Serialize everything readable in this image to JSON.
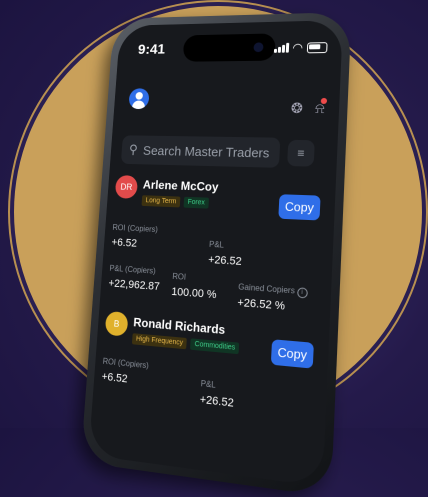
{
  "status": {
    "time": "9:41"
  },
  "search": {
    "placeholder": "Search Master Traders"
  },
  "traders": [
    {
      "initials": "DR",
      "name": "Arlene McCoy",
      "tags": [
        "Long Term",
        "Forex"
      ],
      "copy_label": "Copy",
      "roi_copiers_label": "ROI (Copiers)",
      "roi_copiers_value": "+6.52",
      "pnl_label": "P&L",
      "pnl_value": "+26.52",
      "pnl_copiers_label": "P&L (Copiers)",
      "pnl_copiers_value": "+22,962.87",
      "roi_label": "ROI",
      "roi_value": "100.00 %",
      "gained_copiers_label": "Gained Copiers",
      "gained_copiers_value": "+26.52 %"
    },
    {
      "initials": "B",
      "name": "Ronald Richards",
      "tags": [
        "High Frequency",
        "Commodities"
      ],
      "copy_label": "Copy",
      "roi_copiers_label": "ROI (Copiers)",
      "roi_copiers_value": "+6.52",
      "pnl_label": "P&L",
      "pnl_value": "+26.52"
    }
  ],
  "colors": {
    "accent": "#2f6ee8",
    "ring": "#c9a05a",
    "background": "#241a4a"
  },
  "icons": [
    "user-avatar-icon",
    "headset-icon",
    "bell-icon",
    "search-icon",
    "filter-icon",
    "info-icon"
  ]
}
